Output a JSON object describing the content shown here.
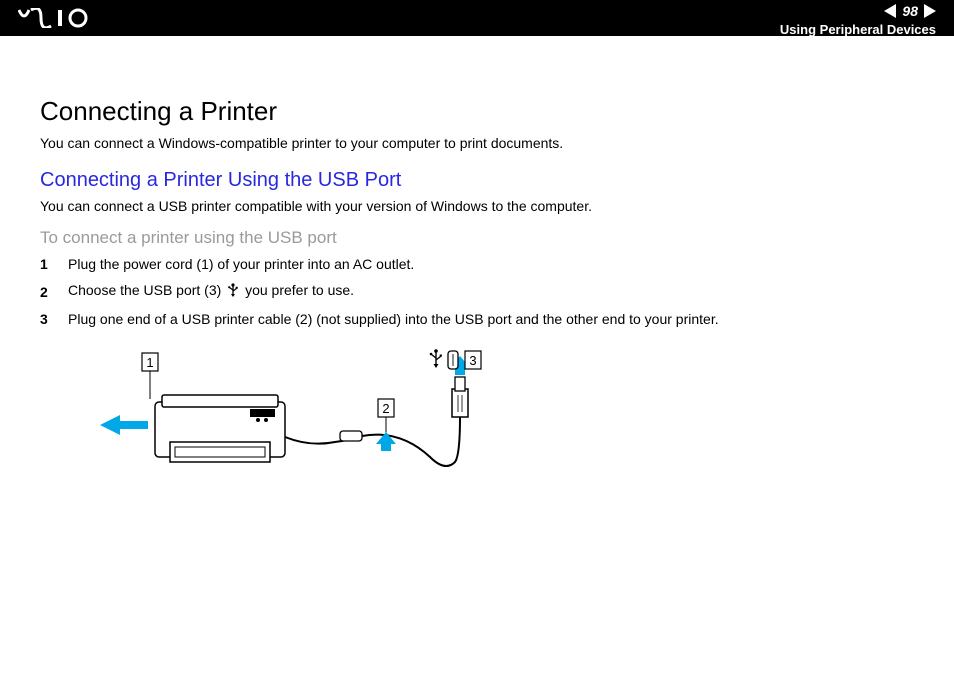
{
  "header": {
    "page_number": "98",
    "section": "Using Peripheral Devices"
  },
  "content": {
    "title": "Connecting a Printer",
    "intro": "You can connect a Windows-compatible printer to your computer to print documents.",
    "subtitle": "Connecting a Printer Using the USB Port",
    "sub_intro": "You can connect a USB printer compatible with your version of Windows to the computer.",
    "procedure_title": "To connect a printer using the USB port",
    "steps": {
      "s1": "Plug the power cord (1) of your printer into an AC outlet.",
      "s2a": "Choose the USB port (3)",
      "s2b": "you prefer to use.",
      "s3": "Plug one end of a USB printer cable (2) (not supplied) into the USB port and the other end to your printer."
    },
    "callouts": {
      "c1": "1",
      "c2": "2",
      "c3": "3"
    }
  }
}
